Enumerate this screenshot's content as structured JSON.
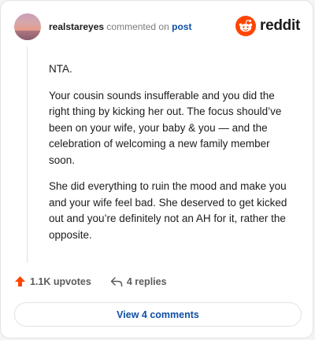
{
  "header": {
    "username": "realstareyes",
    "action_text": "commented on",
    "post_link": "post"
  },
  "brand": {
    "name": "reddit",
    "icon": "reddit-logo-icon",
    "color": "#ff4500"
  },
  "comment": {
    "paragraphs": [
      "NTA.",
      "Your cousin sounds insufferable and you did the right thing by kicking her out. The focus should’ve been on your wife, your baby & you — and the celebration of welcoming a new family member soon.",
      "She did everything to ruin the mood and make you and your wife feel bad. She deserved to get kicked out and you’re definitely not an AH for it, rather the opposite."
    ]
  },
  "actions": {
    "upvotes_label": "1.1K upvotes",
    "upvote_icon": "upvote-arrow-icon",
    "upvote_color": "#ff4500",
    "replies_label": "4 replies",
    "reply_icon": "reply-arrow-icon"
  },
  "footer": {
    "view_comments_label": "View 4 comments",
    "link_color": "#0e4fa6"
  }
}
